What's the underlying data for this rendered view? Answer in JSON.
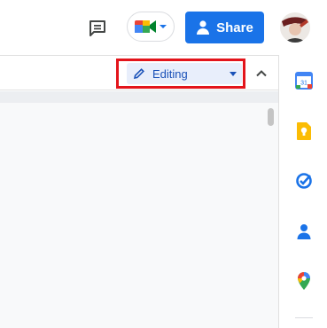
{
  "header": {
    "share_label": "Share",
    "icons": {
      "comment": "comment-history-icon",
      "meet": "google-meet-icon",
      "share": "person-add-icon",
      "avatar": "user-avatar"
    }
  },
  "toolbar": {
    "mode": {
      "label": "Editing",
      "icon": "pencil-icon",
      "highlighted": true,
      "highlight_color": "#e3141b"
    },
    "collapse_icon": "chevron-up-icon"
  },
  "side_panel": {
    "items": [
      {
        "name": "calendar",
        "icon": "google-calendar-icon",
        "label": "31"
      },
      {
        "name": "keep",
        "icon": "google-keep-icon"
      },
      {
        "name": "tasks",
        "icon": "google-tasks-icon"
      },
      {
        "name": "contacts",
        "icon": "google-contacts-icon"
      },
      {
        "name": "maps",
        "icon": "google-maps-icon"
      }
    ]
  },
  "colors": {
    "accent": "#1a73e8",
    "mode_text": "#1a51b8",
    "mode_bg": "#e8eefb"
  }
}
